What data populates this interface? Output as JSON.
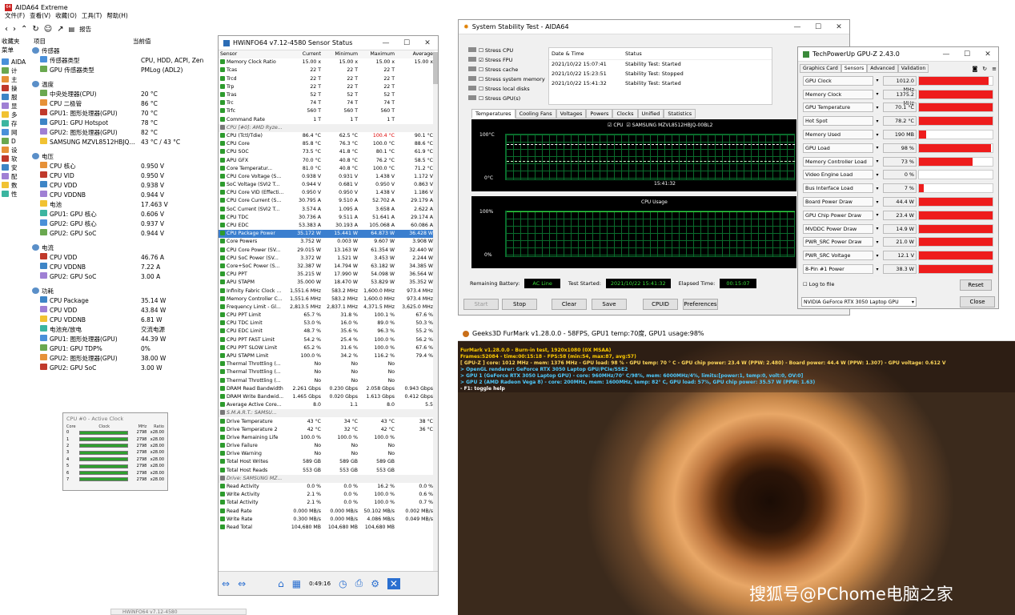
{
  "aida": {
    "title": "AIDA64 Extreme",
    "menu": [
      "文件(F)",
      "查看(V)",
      "收藏(O)",
      "工具(T)",
      "帮助(H)"
    ],
    "report": "报告",
    "col_item": "项目",
    "col_value": "当前值",
    "left_tabs": [
      "收藏夹",
      "菜单"
    ],
    "sections": [
      {
        "name": "传感器",
        "rows": [
          {
            "k": "传感器类型",
            "v": "CPU, HDD, ACPI, Zen"
          },
          {
            "k": "GPU 传感器类型",
            "v": "PMLog (ADL2)"
          }
        ]
      },
      {
        "name": "温度",
        "rows": [
          {
            "k": "中央处理器(CPU)",
            "v": "20 °C"
          },
          {
            "k": "CPU 二极管",
            "v": "86 °C"
          },
          {
            "k": "GPU1: 图形处理器(GPU)",
            "v": "70 °C"
          },
          {
            "k": "GPU1: GPU Hotspot",
            "v": "78 °C"
          },
          {
            "k": "GPU2: 图形处理器(GPU)",
            "v": "82 °C"
          },
          {
            "k": "SAMSUNG MZVL8512HBJQ...",
            "v": "43 °C / 43 °C"
          }
        ]
      },
      {
        "name": "电压",
        "rows": [
          {
            "k": "CPU 核心",
            "v": "0.950 V"
          },
          {
            "k": "CPU VID",
            "v": "0.950 V"
          },
          {
            "k": "CPU VDD",
            "v": "0.938 V"
          },
          {
            "k": "CPU VDDNB",
            "v": "0.944 V"
          },
          {
            "k": "电池",
            "v": "17.463 V"
          },
          {
            "k": "GPU1: GPU 核心",
            "v": "0.606 V"
          },
          {
            "k": "GPU2: GPU 核心",
            "v": "0.937 V"
          },
          {
            "k": "GPU2: GPU SoC",
            "v": "0.944 V"
          }
        ]
      },
      {
        "name": "电流",
        "rows": [
          {
            "k": "CPU VDD",
            "v": "46.76 A"
          },
          {
            "k": "CPU VDDNB",
            "v": "7.22 A"
          },
          {
            "k": "GPU2: GPU SoC",
            "v": "3.00 A"
          }
        ]
      },
      {
        "name": "功耗",
        "rows": [
          {
            "k": "CPU Package",
            "v": "35.14 W"
          },
          {
            "k": "CPU VDD",
            "v": "43.84 W"
          },
          {
            "k": "CPU VDDNB",
            "v": "6.81 W"
          },
          {
            "k": "电池充/放电",
            "v": "交流电源"
          },
          {
            "k": "GPU1: 图形处理器(GPU)",
            "v": "44.39 W"
          },
          {
            "k": "GPU1: GPU TDP%",
            "v": "0%"
          },
          {
            "k": "GPU2: 图形处理器(GPU)",
            "v": "38.00 W"
          },
          {
            "k": "GPU2: GPU SoC",
            "v": "3.00 W"
          }
        ]
      }
    ],
    "left_items": [
      "AIDA",
      "计",
      "主",
      "操",
      "服",
      "显",
      "多",
      "存",
      "网",
      "D",
      "设",
      "软",
      "安",
      "配",
      "数",
      "性"
    ]
  },
  "clock": {
    "title": "CPU #0 - Active Clock",
    "headers": [
      "Core",
      "Clock",
      "MHz",
      "Ratio"
    ],
    "cores": [
      {
        "c": "0",
        "mhz": "2798",
        "r": "x28.00"
      },
      {
        "c": "1",
        "mhz": "2798",
        "r": "x28.00"
      },
      {
        "c": "2",
        "mhz": "2798",
        "r": "x28.00"
      },
      {
        "c": "3",
        "mhz": "2798",
        "r": "x28.00"
      },
      {
        "c": "4",
        "mhz": "2798",
        "r": "x28.00"
      },
      {
        "c": "5",
        "mhz": "2798",
        "r": "x28.00"
      },
      {
        "c": "6",
        "mhz": "2798",
        "r": "x28.00"
      },
      {
        "c": "7",
        "mhz": "2798",
        "r": "x28.00"
      }
    ]
  },
  "hwinfo": {
    "title": "HWiNFO64 v7.12-4580 Sensor Status",
    "headers": [
      "Sensor",
      "Current",
      "Minimum",
      "Maximum",
      "Average"
    ],
    "time": "0:49:16",
    "rows": [
      [
        "Memory Clock Ratio",
        "15.00 x",
        "15.00 x",
        "15.00 x",
        "15.00 x"
      ],
      [
        "Tcas",
        "22 T",
        "22 T",
        "22 T",
        ""
      ],
      [
        "Trcd",
        "22 T",
        "22 T",
        "22 T",
        ""
      ],
      [
        "Trp",
        "22 T",
        "22 T",
        "22 T",
        ""
      ],
      [
        "Tras",
        "52 T",
        "52 T",
        "52 T",
        ""
      ],
      [
        "Trc",
        "74 T",
        "74 T",
        "74 T",
        ""
      ],
      [
        "Trfc",
        "560 T",
        "560 T",
        "560 T",
        ""
      ],
      [
        "Command Rate",
        "1 T",
        "1 T",
        "1 T",
        ""
      ],
      [
        "#CPU [#0]: AMD Ryze...",
        "",
        "",
        "",
        ""
      ],
      [
        "CPU (Tctl/Tdie)",
        "86.4 °C",
        "62.5 °C",
        "100.4 °C",
        "90.1 °C"
      ],
      [
        "CPU Core",
        "85.8 °C",
        "76.3 °C",
        "100.0 °C",
        "88.6 °C"
      ],
      [
        "CPU SOC",
        "73.5 °C",
        "41.8 °C",
        "80.1 °C",
        "61.9 °C"
      ],
      [
        "APU GFX",
        "70.0 °C",
        "40.8 °C",
        "76.2 °C",
        "58.5 °C"
      ],
      [
        "Core Temperatur...",
        "81.0 °C",
        "40.8 °C",
        "100.0 °C",
        "71.2 °C"
      ],
      [
        "CPU Core Voltage (S...",
        "0.938 V",
        "0.931 V",
        "1.438 V",
        "1.172 V"
      ],
      [
        "SoC Voltage (SVI2 T...",
        "0.944 V",
        "0.681 V",
        "0.950 V",
        "0.863 V"
      ],
      [
        "CPU Core VID (Effecti...",
        "0.950 V",
        "0.950 V",
        "1.438 V",
        "1.186 V"
      ],
      [
        "CPU Core Current (S...",
        "30.795 A",
        "9.510 A",
        "52.702 A",
        "29.179 A"
      ],
      [
        "SoC Current (SVI2 T...",
        "3.574 A",
        "1.095 A",
        "3.658 A",
        "2.622 A"
      ],
      [
        "CPU TDC",
        "30.736 A",
        "9.511 A",
        "51.641 A",
        "29.174 A"
      ],
      [
        "CPU EDC",
        "53.383 A",
        "30.193 A",
        "105.068 A",
        "60.086 A"
      ],
      [
        "*CPU Package Power",
        "35.172 W",
        "15.441 W",
        "64.873 W",
        "36.428 W"
      ],
      [
        "Core Powers",
        "3.752 W",
        "0.003 W",
        "9.607 W",
        "3.908 W"
      ],
      [
        "CPU Core Power (SV...",
        "29.015 W",
        "13.163 W",
        "61.354 W",
        "32.440 W"
      ],
      [
        "CPU SoC Power (SV...",
        "3.372 W",
        "1.521 W",
        "3.453 W",
        "2.244 W"
      ],
      [
        "Core+SoC Power (S...",
        "32.387 W",
        "14.794 W",
        "63.182 W",
        "34.385 W"
      ],
      [
        "CPU PPT",
        "35.215 W",
        "17.990 W",
        "54.098 W",
        "36.564 W"
      ],
      [
        "APU STAPM",
        "35.000 W",
        "18.470 W",
        "53.829 W",
        "35.352 W"
      ],
      [
        "Infinity Fabric Clock ...",
        "1,551.6 MHz",
        "583.2 MHz",
        "1,600.0 MHz",
        "973.4 MHz"
      ],
      [
        "Memory Controller C...",
        "1,551.6 MHz",
        "583.2 MHz",
        "1,600.0 MHz",
        "973.4 MHz"
      ],
      [
        "Frequency Limit - Gl...",
        "2,813.5 MHz",
        "2,837.1 MHz",
        "4,371.5 MHz",
        "3,625.0 MHz"
      ],
      [
        "CPU PPT Limit",
        "65.7 %",
        "31.8 %",
        "100.1 %",
        "67.6 %"
      ],
      [
        "CPU TDC Limit",
        "53.0 %",
        "16.0 %",
        "89.0 %",
        "50.3 %"
      ],
      [
        "CPU EDC Limit",
        "48.7 %",
        "35.6 %",
        "96.3 %",
        "55.2 %"
      ],
      [
        "CPU PPT FAST Limit",
        "54.2 %",
        "25.4 %",
        "100.0 %",
        "56.2 %"
      ],
      [
        "CPU PPT SLOW Limit",
        "65.2 %",
        "31.6 %",
        "100.0 %",
        "67.6 %"
      ],
      [
        "APU STAPM Limit",
        "100.0 %",
        "34.2 %",
        "116.2 %",
        "79.4 %"
      ],
      [
        "Thermal Throttling (...",
        "No",
        "No",
        "No",
        ""
      ],
      [
        "Thermal Throttling (...",
        "No",
        "No",
        "No",
        ""
      ],
      [
        "Thermal Throttling (...",
        "No",
        "No",
        "No",
        ""
      ],
      [
        "DRAM Read Bandwidth",
        "2.261 Gbps",
        "0.230 Gbps",
        "2.058 Gbps",
        "0.943 Gbps"
      ],
      [
        "DRAM Write Bandwid...",
        "1.465 Gbps",
        "0.020 Gbps",
        "1.613 Gbps",
        "0.412 Gbps"
      ],
      [
        "Average Active Core...",
        "8.0",
        "1.1",
        "8.0",
        "5.5"
      ],
      [
        "#S.M.A.R.T.: SAMSU...",
        "",
        "",
        "",
        ""
      ],
      [
        "Drive Temperature",
        "43 °C",
        "34 °C",
        "43 °C",
        "38 °C"
      ],
      [
        "Drive Temperature 2",
        "42 °C",
        "32 °C",
        "42 °C",
        "36 °C"
      ],
      [
        "Drive Remaining Life",
        "100.0 %",
        "100.0 %",
        "100.0 %",
        ""
      ],
      [
        "Drive Failure",
        "No",
        "No",
        "No",
        ""
      ],
      [
        "Drive Warning",
        "No",
        "No",
        "No",
        ""
      ],
      [
        "Total Host Writes",
        "589 GB",
        "589 GB",
        "589 GB",
        ""
      ],
      [
        "Total Host Reads",
        "553 GB",
        "553 GB",
        "553 GB",
        ""
      ],
      [
        "#Drive: SAMSUNG MZ...",
        "",
        "",
        "",
        ""
      ],
      [
        "Read Activity",
        "0.0 %",
        "0.0 %",
        "16.2 %",
        "0.0 %"
      ],
      [
        "Write Activity",
        "2.1 %",
        "0.0 %",
        "100.0 %",
        "0.6 %"
      ],
      [
        "Total Activity",
        "2.1 %",
        "0.0 %",
        "100.0 %",
        "0.7 %"
      ],
      [
        "Read Rate",
        "0.000 MB/s",
        "0.000 MB/s",
        "50.102 MB/s",
        "0.002 MB/s"
      ],
      [
        "Write Rate",
        "0.300 MB/s",
        "0.000 MB/s",
        "4.086 MB/s",
        "0.049 MB/s"
      ],
      [
        "Read Total",
        "104,680 MB",
        "104,680 MB",
        "104,680 MB",
        ""
      ]
    ]
  },
  "stab": {
    "title": "System Stability Test - AIDA64",
    "checks": [
      {
        "l": "Stress CPU",
        "c": false
      },
      {
        "l": "Stress FPU",
        "c": true
      },
      {
        "l": "Stress cache",
        "c": false
      },
      {
        "l": "Stress system memory",
        "c": false
      },
      {
        "l": "Stress local disks",
        "c": false
      },
      {
        "l": "Stress GPU(s)",
        "c": false
      }
    ],
    "log_headers": [
      "Date & Time",
      "Status"
    ],
    "log": [
      {
        "t": "2021/10/22 15:07:41",
        "s": "Stability Test: Started"
      },
      {
        "t": "2021/10/22 15:23:51",
        "s": "Stability Test: Stopped"
      },
      {
        "t": "2021/10/22 15:41:32",
        "s": "Stability Test: Started"
      }
    ],
    "tabs": [
      "Temperatures",
      "Cooling Fans",
      "Voltages",
      "Powers",
      "Clocks",
      "Unified",
      "Statistics"
    ],
    "legend": [
      "CPU",
      "SAMSUNG MZVL8512HBJQ-00BL2"
    ],
    "temp_top": "100°C",
    "temp_bot": "0°C",
    "temp_time": "15:41:32",
    "cpu_title": "CPU Usage",
    "cpu_top": "100%",
    "cpu_bot": "0%",
    "rb_label": "Remaining Battery:",
    "rb": "AC Line",
    "ts_label": "Test Started:",
    "ts": "2021/10/22 15:41:32",
    "el_label": "Elapsed Time:",
    "el": "00:15:07",
    "buttons": [
      "Start",
      "Stop",
      "Clear",
      "Save",
      "CPUID",
      "Preferences"
    ]
  },
  "gpuz": {
    "title": "TechPowerUp GPU-Z 2.43.0",
    "tabs": [
      "Graphics Card",
      "Sensors",
      "Advanced",
      "Validation"
    ],
    "sensors": [
      {
        "n": "GPU Clock",
        "v": "1012.0 MHz",
        "f": 0.95
      },
      {
        "n": "Memory Clock",
        "v": "1375.2 MHz",
        "f": 1
      },
      {
        "n": "GPU Temperature",
        "v": "70.1 °C",
        "f": 1
      },
      {
        "n": "Hot Spot",
        "v": "78.2 °C",
        "f": 1
      },
      {
        "n": "Memory Used",
        "v": "190 MB",
        "f": 0.1
      },
      {
        "n": "GPU Load",
        "v": "98 %",
        "f": 0.98
      },
      {
        "n": "Memory Controller Load",
        "v": "73 %",
        "f": 0.73
      },
      {
        "n": "Video Engine Load",
        "v": "0 %",
        "f": 0
      },
      {
        "n": "Bus Interface Load",
        "v": "7 %",
        "f": 0.07
      },
      {
        "n": "Board Power Draw",
        "v": "44.4 W",
        "f": 1
      },
      {
        "n": "GPU Chip Power Draw",
        "v": "23.4 W",
        "f": 1
      },
      {
        "n": "MVDDC Power Draw",
        "v": "14.9 W",
        "f": 1
      },
      {
        "n": "PWR_SRC Power Draw",
        "v": "21.0 W",
        "f": 1
      },
      {
        "n": "PWR_SRC Voltage",
        "v": "12.1 V",
        "f": 1
      },
      {
        "n": "8-Pin #1 Power",
        "v": "38.3 W",
        "f": 1
      }
    ],
    "log": "Log to file",
    "reset": "Reset",
    "gpu": "NVIDIA GeForce RTX 3050 Laptop GPU",
    "close": "Close"
  },
  "furmark": {
    "title": "Geeks3D FurMark v1.28.0.0 - 58FPS, GPU1 temp:70度, GPU1 usage:98%",
    "lines": [
      "FurMark v1.28.0.0 - Burn-in test, 1920x1080 (0X MSAA)",
      "Frames:52084 - time:00:15:18 - FPS:58 (min:54, max:87, avg:57)",
      "[ GPU-Z ] core: 1012 MHz - mem: 1376 MHz - GPU load: 98 % - GPU temp: 70 ° C - GPU chip power: 23.4 W (PPW: 2.480) - Board power: 44.4 W (PPW: 1.307) - GPU voltage: 0.612 V",
      "> OpenGL renderer: GeForce RTX 3050 Laptop GPU/PCIe/SSE2",
      "> GPU 1 (GeForce RTX 3050 Laptop GPU) - core: 960MHz/70° C/98%, mem: 6000MHz/4%, limits:[power:1, temp:0, volt:0, OV:0]",
      "> GPU 2 (AMD Radeon Vega 8) - core: 200MHz, mem: 1600MHz, temp: 82° C, GPU load: 57%, GPU chip power: 35.57 W (PPW: 1.63)",
      "- F1: toggle help"
    ],
    "watermark": "搜狐号@PChome电脑之家"
  },
  "taskbar": {
    "item": "HWiNFO64 v7.12-4580"
  }
}
